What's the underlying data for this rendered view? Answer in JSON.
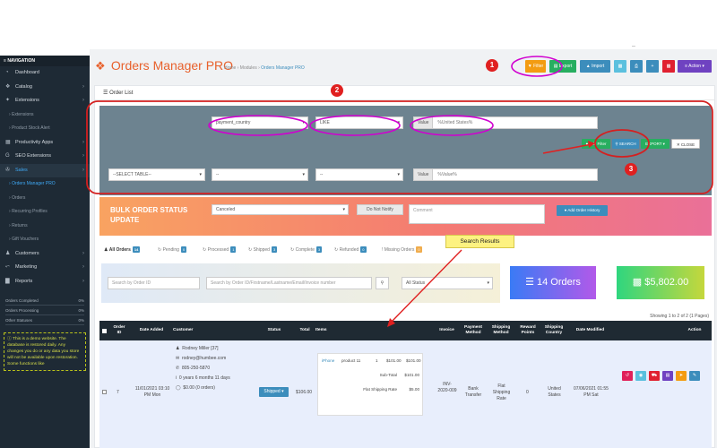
{
  "sidebar": {
    "nav_header": "NAVIGATION",
    "items": [
      {
        "label": "Dashboard",
        "icon": "dashboard-icon",
        "chevron": false
      },
      {
        "label": "Catalog",
        "icon": "tag-icon",
        "chevron": true
      },
      {
        "label": "Extensions",
        "icon": "puzzle-icon",
        "chevron": true
      },
      {
        "label": "Extensions",
        "sub": true
      },
      {
        "label": "Product Stock Alert",
        "sub": true
      },
      {
        "label": "Productivity Apps",
        "icon": "grid-icon",
        "chevron": true
      },
      {
        "label": "SEO Extensions",
        "icon": "google-icon",
        "chevron": true
      },
      {
        "label": "Sales",
        "icon": "cart-icon",
        "chevron": true
      },
      {
        "label": "Orders Manager PRO",
        "sub": true
      },
      {
        "label": "Orders",
        "sub": true
      },
      {
        "label": "Recurring Profiles",
        "sub": true
      },
      {
        "label": "Returns",
        "sub": true
      },
      {
        "label": "Gift Vouchers",
        "sub": true
      },
      {
        "label": "Customers",
        "icon": "user-icon",
        "chevron": true
      },
      {
        "label": "Marketing",
        "icon": "share-icon",
        "chevron": true
      },
      {
        "label": "Reports",
        "icon": "bar-chart-icon",
        "chevron": true
      }
    ],
    "stats": [
      {
        "label": "Orders Completed",
        "value": "0%"
      },
      {
        "label": "Orders Processing",
        "value": "0%"
      },
      {
        "label": "Other Statuses",
        "value": "0%"
      }
    ],
    "demo_note": "This is a demo website. The database is restored daily. Any changes you do or any data you store will not be available upon restoration. Some functions like"
  },
  "header": {
    "title": "Orders Manager PRO",
    "breadcrumb": [
      "Home",
      "Modules",
      "Orders Manager PRO"
    ],
    "buttons": {
      "filter": "Filter",
      "export": "Export",
      "import": "Import",
      "action": "Action"
    }
  },
  "card_title": "Order List",
  "filter": {
    "field": "payment_country",
    "operator": "LIKE",
    "value_label": "Value",
    "value": "%United States%",
    "search": "SEARCH",
    "export": "EXPORT",
    "close": "CLOSE",
    "add_filter": "Add Filter",
    "table_select": "--SELECT TABLE--",
    "dash1": "--",
    "dash2": "--",
    "value2_label": "Value",
    "value2_placeholder": "%Value%"
  },
  "bulk": {
    "title_line1": "BULK ORDER STATUS",
    "title_line2": "UPDATE",
    "status": "Canceled",
    "notify": "Do Not Notify",
    "comment_placeholder": "Comment",
    "add_history": "Add Order History"
  },
  "tabs": [
    {
      "label": "All Orders",
      "count": "14",
      "color": "#3c8dbc"
    },
    {
      "label": "Pending",
      "count": "0",
      "color": "#3c8dbc"
    },
    {
      "label": "Processed",
      "count": "1",
      "color": "#3c8dbc"
    },
    {
      "label": "Shipped",
      "count": "3",
      "color": "#3c8dbc"
    },
    {
      "label": "Complete",
      "count": "3",
      "color": "#3c8dbc"
    },
    {
      "label": "Refunded",
      "count": "0",
      "color": "#3c8dbc"
    },
    {
      "label": "Missing Orders",
      "count": "0",
      "color": "#f0ad4e"
    }
  ],
  "search": {
    "order_id_placeholder": "Search by Order ID",
    "customer_placeholder": "Search by Order ID/Firstname/Lastname/Email/Invoice number",
    "status": "All Status",
    "orders_count": "14 Orders",
    "total": "$5,802.00"
  },
  "showing": "Showing 1 to 2 of 2 (1 Pages)",
  "table": {
    "headers": [
      "Order ID",
      "Date Added",
      "Customer",
      "Status",
      "Total",
      "Items",
      "Invoice",
      "Payment Method",
      "Shipping Method",
      "Reward Points",
      "Shipping Country",
      "Date Modified",
      "Action"
    ],
    "row": {
      "order_id": "7",
      "date_added": "11/01/2021 03:10 PM Mon",
      "customer_name": "Rodney Miller [37]",
      "email": "rodney@humbee.com",
      "phone": "805-250-5870",
      "since": "0 years 6 months 11 days",
      "orders": "$0.00 (0 orders)",
      "status": "Shipped",
      "total": "$106.00",
      "item_name": "iPhone",
      "item_model": "product 11",
      "item_qty": "1",
      "item_price": "$101.00",
      "item_total": "$101.00",
      "subtotal_label": "Sub-Total",
      "subtotal": "$101.00",
      "shipping_label": "Flat Shipping Rate",
      "shipping": "$5.00",
      "invoice": "INV-2020-009",
      "payment": "Bank Transfer",
      "shipping_method": "Flat Shipping Rate",
      "reward": "0",
      "country": "United States",
      "date_modified": "07/06/2021 01:55 PM Sat"
    }
  },
  "annotations": {
    "n1": "1",
    "n2": "2",
    "n3": "3",
    "tip": "Search Results"
  },
  "colors": {
    "accent": "#3c8dbc",
    "title": "#e8612c",
    "annotation": "#d000d0",
    "marker": "#e02020"
  }
}
